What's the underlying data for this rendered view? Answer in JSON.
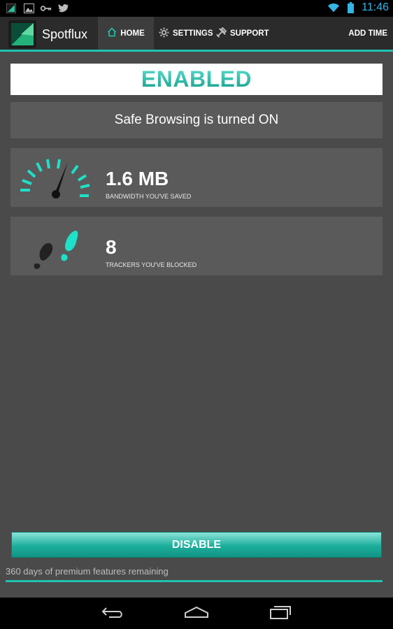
{
  "status_bar": {
    "time": "11:46",
    "icons": [
      "spotflux-notification-icon",
      "image-icon",
      "key-icon",
      "twitter-icon",
      "wifi-icon",
      "battery-icon"
    ]
  },
  "action_bar": {
    "app_title": "Spotflux",
    "tabs": [
      {
        "label": "HOME",
        "icon": "home-icon",
        "selected": true
      },
      {
        "label": "SETTINGS",
        "icon": "gear-icon",
        "selected": false
      },
      {
        "label": "SUPPORT",
        "icon": "tools-icon",
        "selected": false
      }
    ],
    "add_time_label": "ADD TIME"
  },
  "status": {
    "enabled_label": "ENABLED",
    "safe_browsing_text": "Safe Browsing is turned ON"
  },
  "stats": [
    {
      "value": "1.6 MB",
      "caption": "BANDWIDTH YOU'VE SAVED",
      "icon": "speedometer-icon"
    },
    {
      "value": "8",
      "caption": "TRACKERS YOU'VE BLOCKED",
      "icon": "footprints-icon"
    }
  ],
  "footer": {
    "disable_label": "DISABLE",
    "premium_text": "360 days of premium features remaining",
    "progress_fraction": 1.0
  },
  "colors": {
    "accent": "#1fc4b0",
    "background": "#4a4a4a",
    "card": "#5a5a5a",
    "status_clock": "#33b5e5"
  }
}
